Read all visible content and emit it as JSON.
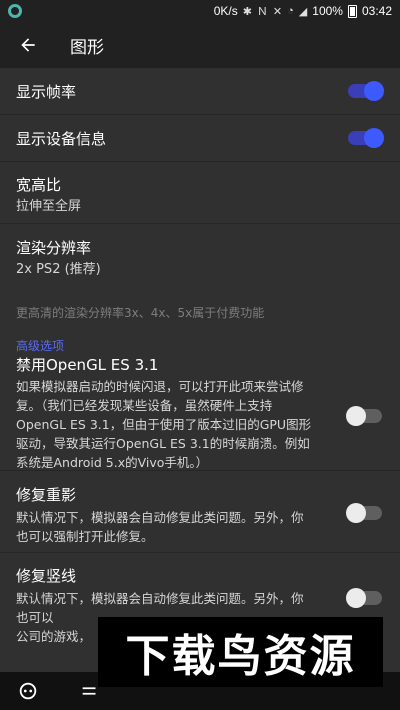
{
  "status": {
    "speed": "0K/s",
    "battery_pct": "100%",
    "time": "03:42"
  },
  "appbar": {
    "title": "图形"
  },
  "rows": {
    "show_fps": {
      "title": "显示帧率",
      "enabled": true
    },
    "show_device_info": {
      "title": "显示设备信息",
      "enabled": true
    },
    "aspect_ratio": {
      "title": "宽高比",
      "value": "拉伸至全屏"
    },
    "render_resolution": {
      "title": "渲染分辨率",
      "value": "2x PS2 (推荐)"
    },
    "render_note": "更高清的渲染分辨率3x、4x、5x属于付费功能",
    "advanced_header": "高级选项",
    "disable_gles31": {
      "title": "禁用OpenGL ES 3.1",
      "desc": "如果模拟器启动的时候闪退，可以打开此项来尝试修复。（我们已经发现某些设备，虽然硬件上支持OpenGL ES 3.1，但由于使用了版本过旧的GPU图形驱动，导致其运行OpenGL ES 3.1的时候崩溃。例如系统是Android 5.x的Vivo手机。）",
      "enabled": false
    },
    "fix_ghosting": {
      "title": "修复重影",
      "desc": "默认情况下，模拟器会自动修复此类问题。另外，你也可以强制打开此修复。",
      "enabled": false
    },
    "fix_vertical_lines": {
      "title": "修复竖线",
      "desc": "默认情况下，模拟器会自动修复此类问题。另外，你也可以",
      "desc_line3": "公司的游戏，",
      "enabled": false
    }
  },
  "watermark": "下载鸟资源",
  "colors": {
    "accent": "#3d5afe",
    "section": "#5a6bf2",
    "background": "#303030",
    "bar": "#212121"
  }
}
